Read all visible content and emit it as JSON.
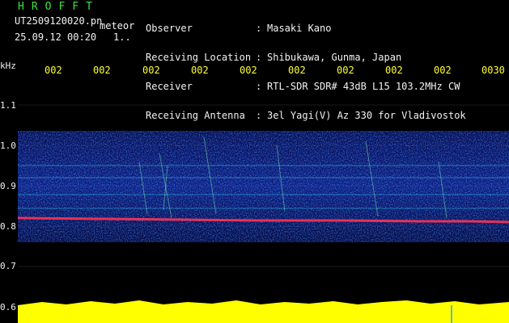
{
  "header": {
    "app_name": "HROFFT",
    "filename": "UT2509120020.pn",
    "filename_suffix": "meteor",
    "datetime": "25.09.12 00:20",
    "counter": "1..",
    "meta": [
      {
        "label": "Observer",
        "sep": ":",
        "value": "Masaki Kano"
      },
      {
        "label": "Receiving Location",
        "sep": ":",
        "value": "Shibukawa, Gunma, Japan"
      },
      {
        "label": "Receiver",
        "sep": ":",
        "value": "RTL-SDR SDR# 43dB L15 103.2MHz CW"
      },
      {
        "label": "Receiving Antenna",
        "sep": ":",
        "value": "3el Yagi(V) Az 330 for Vladivostok"
      }
    ]
  },
  "axis": {
    "unit": "kHz",
    "freq_ticks": [
      "1.1",
      "1.0",
      "0.9",
      "0.8",
      "0.7",
      "0.6"
    ],
    "time_ticks": [
      "002",
      "002",
      "002",
      "002",
      "002",
      "002",
      "002",
      "002",
      "002",
      "0030"
    ]
  },
  "colors": {
    "background": "#000000",
    "title_green": "#3fe03f",
    "text": "#f2f2f2",
    "time_labels": "#ffff33",
    "signal_trace": "#ff3355",
    "noise_band": "#1a3cff",
    "amplitude_bars": "#ffff00"
  }
}
